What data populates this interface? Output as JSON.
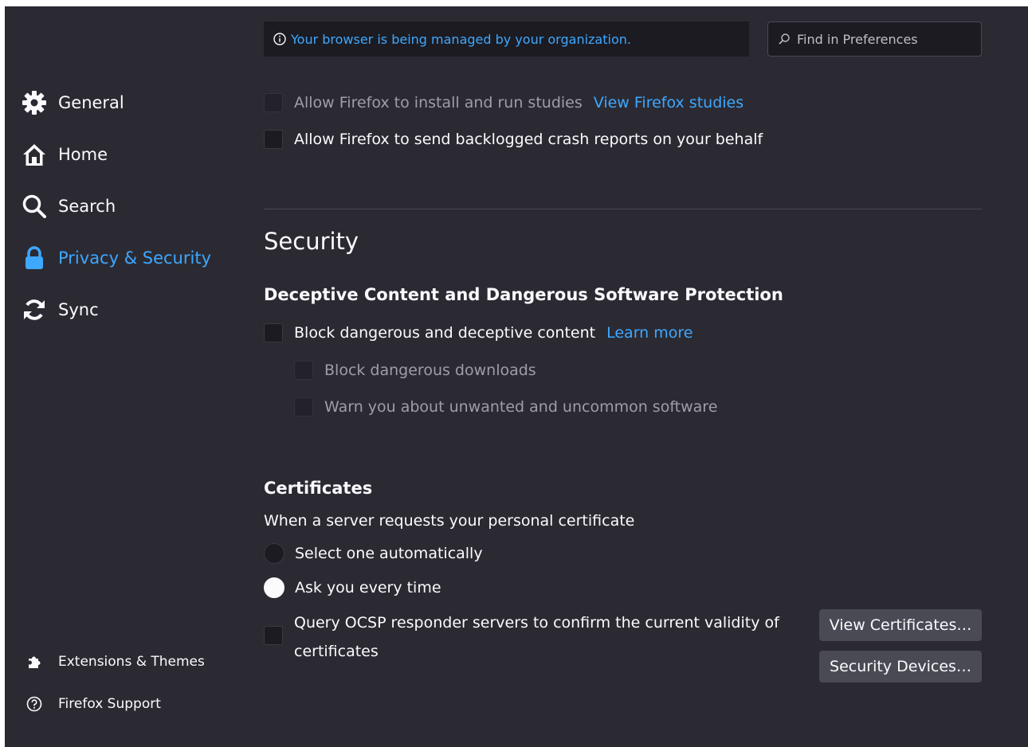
{
  "header": {
    "managed_notice": "Your browser is being managed by your organization.",
    "search_placeholder": "Find in Preferences"
  },
  "sidebar": {
    "items": [
      {
        "label": "General",
        "icon": "gear-icon"
      },
      {
        "label": "Home",
        "icon": "home-icon"
      },
      {
        "label": "Search",
        "icon": "search-icon"
      },
      {
        "label": "Privacy & Security",
        "icon": "lock-icon",
        "selected": true
      },
      {
        "label": "Sync",
        "icon": "sync-icon"
      }
    ],
    "footer": [
      {
        "label": "Extensions & Themes",
        "icon": "puzzle-icon"
      },
      {
        "label": "Firefox Support",
        "icon": "help-icon"
      }
    ]
  },
  "data_collection": {
    "studies_label": "Allow Firefox to install and run studies",
    "studies_link": "View Firefox studies",
    "crash_label": "Allow Firefox to send backlogged crash reports on your behalf"
  },
  "security": {
    "title": "Security",
    "deceptive_heading": "Deceptive Content and Dangerous Software Protection",
    "block_label": "Block dangerous and deceptive content",
    "learn_more": "Learn more",
    "block_downloads_label": "Block dangerous downloads",
    "warn_unwanted_label": "Warn you about unwanted and uncommon software"
  },
  "certificates": {
    "heading": "Certificates",
    "prompt": "When a server requests your personal certificate",
    "option_auto": "Select one automatically",
    "option_ask": "Ask you every time",
    "selected_option": "Ask you every time",
    "ocsp_label": "Query OCSP responder servers to confirm the current validity of certificates",
    "view_button": "View Certificates…",
    "devices_button": "Security Devices…"
  },
  "colors": {
    "background": "#2b2a33",
    "field_background": "#1c1b22",
    "accent": "#3ea8ff",
    "text": "#fbfbfe",
    "button": "#4a4a55"
  }
}
